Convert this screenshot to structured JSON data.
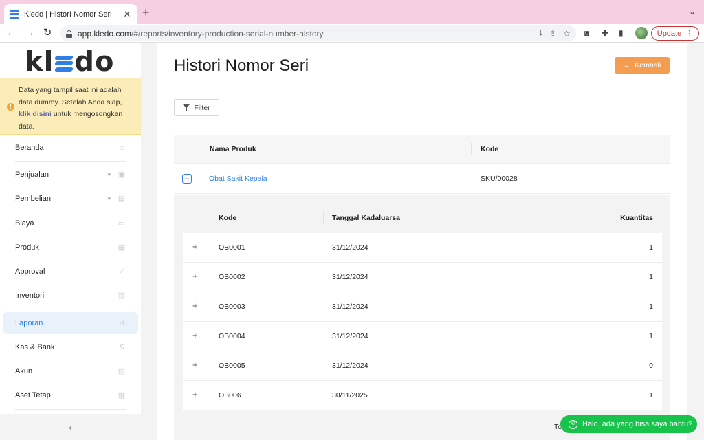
{
  "browser": {
    "tab_title": "Kledo | Historí Nomor Seri",
    "url_host": "app.kledo.com",
    "url_path": "/#/reports/inventory-production-serial-number-history",
    "update_label": "Update"
  },
  "sidebar": {
    "logo_k": "kl",
    "logo_do": "do",
    "notice_prefix": "Data yang tampil saat ini adalah data dummy. Setelah Anda siap, ",
    "notice_link": "klik disini",
    "notice_suffix": " untuk mengosongkan data.",
    "items": [
      {
        "label": "Beranda"
      },
      {
        "label": "Penjualan"
      },
      {
        "label": "Pembelian"
      },
      {
        "label": "Biaya"
      },
      {
        "label": "Produk"
      },
      {
        "label": "Approval"
      },
      {
        "label": "Inventori"
      },
      {
        "label": "Laporan"
      },
      {
        "label": "Kas & Bank"
      },
      {
        "label": "Akun"
      },
      {
        "label": "Aset Tetap"
      }
    ]
  },
  "main": {
    "title": "Histori Nomor Seri",
    "back_label": "Kembali",
    "filter_label": "Filter",
    "head_product": "Nama Produk",
    "head_code": "Kode",
    "product_name": "Obat Sakit Kepala",
    "product_sku": "SKU/00028",
    "sub_head": [
      "Kode",
      "Tanggal Kadaluarsa",
      "Kuantitas"
    ],
    "rows": [
      [
        "OB0001",
        "31/12/2024",
        "1"
      ],
      [
        "OB0002",
        "31/12/2024",
        "1"
      ],
      [
        "OB0003",
        "31/12/2024",
        "1"
      ],
      [
        "OB0004",
        "31/12/2024",
        "1"
      ],
      [
        "OB0005",
        "31/12/2024",
        "0"
      ],
      [
        "OB006",
        "30/11/2025",
        "1"
      ]
    ],
    "total_label": "To",
    "chat_label": "Halo, ada yang bisa saya bantu?"
  }
}
